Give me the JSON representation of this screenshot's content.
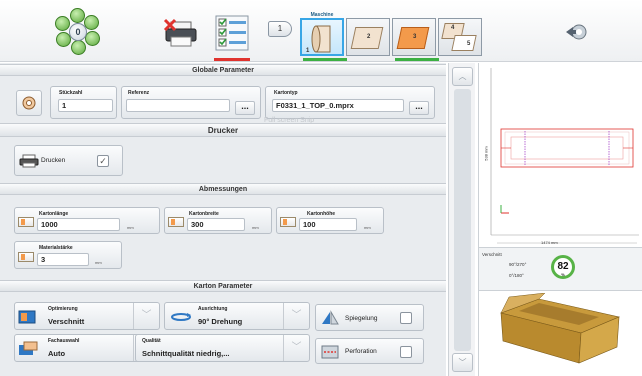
{
  "toolbar": {
    "view_center": "0",
    "tag_number": "1",
    "machine_strip_label": "Maschine",
    "slots": [
      {
        "number": "1",
        "active": true
      },
      {
        "number": "2",
        "active": false
      },
      {
        "number": "3",
        "active": false
      },
      {
        "number": "4",
        "active": false
      },
      {
        "number": "5",
        "active": false
      }
    ]
  },
  "sections": {
    "global": "Globale Parameter",
    "printer": "Drucker",
    "dims": "Abmessungen",
    "box": "Karton Parameter"
  },
  "global": {
    "quantity_label": "Stückzahl",
    "quantity_value": "1",
    "reference_label": "Referenz",
    "reference_value": "",
    "box_type_label": "Kartontyp",
    "box_type_value": "F0331_1_TOP_0.mprx",
    "more": "...",
    "ghost_text": "Full screen Snip"
  },
  "printer": {
    "print_label": "Drucken",
    "print_checked": "✓"
  },
  "dims": {
    "length_label": "Kartonlänge",
    "length_value": "1000",
    "width_label": "Kartonbreite",
    "width_value": "300",
    "height_label": "Kartonhöhe",
    "height_value": "100",
    "thickness_label": "Materialstärke",
    "thickness_value": "3",
    "unit": "mm"
  },
  "box": {
    "opt_label": "Optimierung",
    "opt_value": "Verschnitt",
    "rot_label": "Ausrichtung",
    "rot_value": "90° Drehung",
    "mirror_label": "Spiegelung",
    "feed_label": "Fachauswahl",
    "feed_value": "Auto",
    "quality_label": "Qualität",
    "quality_value": "Schnittqualität niedrig,...",
    "perf_label": "Perforation"
  },
  "preview": {
    "width_dim": "1474 mm",
    "height_dim": "538 mm"
  },
  "waste": {
    "title": "Verschnitt",
    "line1": "90°/270°",
    "line2": "0°/180°",
    "value": "82",
    "unit": "%"
  },
  "colors": {
    "accent": "#38a6e6",
    "red": "#e0332e",
    "green": "#3cb043",
    "orange": "#f39a4b"
  }
}
